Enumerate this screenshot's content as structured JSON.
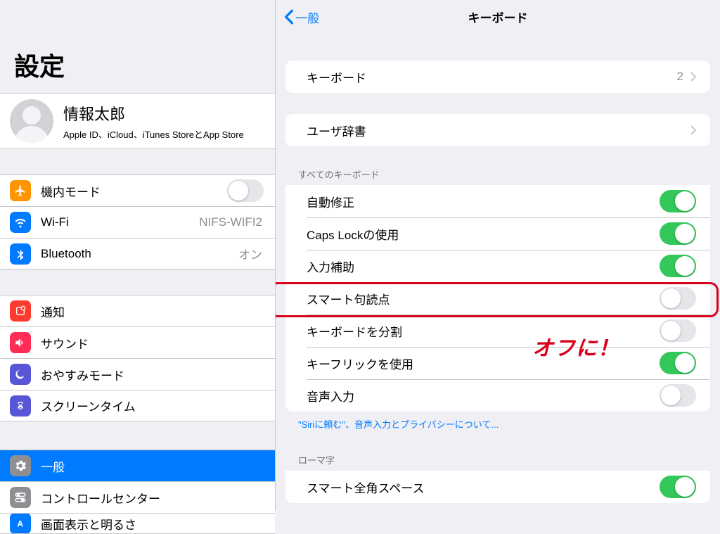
{
  "sidebar": {
    "title": "設定",
    "profile": {
      "name": "情報太郎",
      "sub": "Apple ID、iCloud、iTunes StoreとApp Store"
    },
    "g1": {
      "airplane": "機内モード",
      "wifi": "Wi-Fi",
      "wifi_value": "NIFS-WIFI2",
      "bt": "Bluetooth",
      "bt_value": "オン"
    },
    "g2": {
      "notif": "通知",
      "sound": "サウンド",
      "dnd": "おやすみモード",
      "screentime": "スクリーンタイム"
    },
    "g3": {
      "general": "一般",
      "control": "コントロールセンター",
      "display": "画面表示と明るさ"
    }
  },
  "detail": {
    "back": "一般",
    "title": "キーボード",
    "keyboards": {
      "label": "キーボード",
      "value": "2"
    },
    "userdict": {
      "label": "ユーザ辞書"
    },
    "section_all_header": "すべてのキーボード",
    "rows": {
      "autocorrect": "自動修正",
      "capslock": "Caps Lockの使用",
      "assist": "入力補助",
      "smartpunct": "スマート句読点",
      "split": "キーボードを分割",
      "flick": "キーフリックを使用",
      "dictation": "音声入力"
    },
    "footer_link": "\"Siriに頼む\"、音声入力とプライバシーについて...",
    "section_romaji_header": "ローマ字",
    "romaji_row": "スマート全角スペース",
    "toggles": {
      "autocorrect": true,
      "capslock": true,
      "assist": true,
      "smartpunct": false,
      "split": false,
      "flick": true,
      "dictation": false,
      "romaji": true,
      "airplane": false
    }
  },
  "annotation": "オフに！"
}
